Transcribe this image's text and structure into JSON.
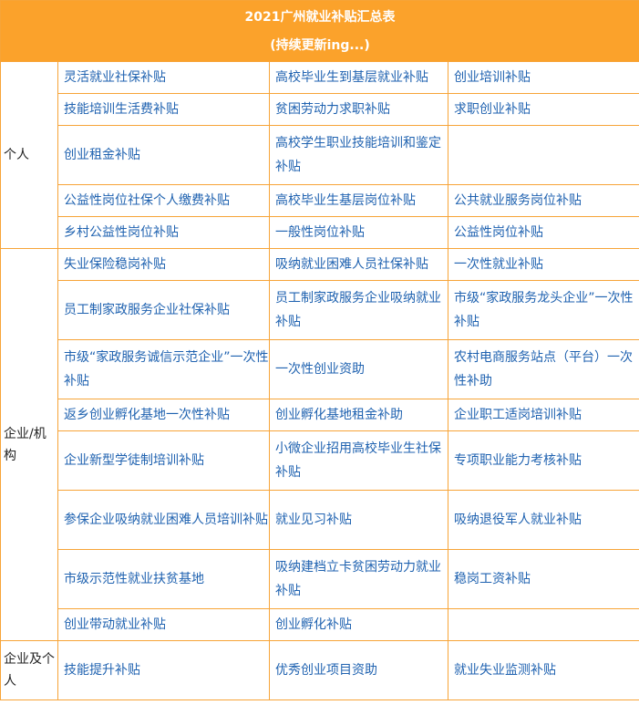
{
  "title": "2021广州就业补贴汇总表",
  "subtitle": "(持续更新ing...)",
  "categories": {
    "individual": "个人",
    "enterprise": "企业/机构",
    "both": "企业及个人"
  },
  "individual_rows": [
    [
      "灵活就业社保补贴",
      "高校毕业生到基层就业补贴",
      "创业培训补贴"
    ],
    [
      "技能培训生活费补贴",
      "贫困劳动力求职补贴",
      "求职创业补贴"
    ],
    [
      "创业租金补贴",
      "高校学生职业技能培训和鉴定补贴",
      ""
    ],
    [
      "公益性岗位社保个人缴费补贴",
      "高校毕业生基层岗位补贴",
      "公共就业服务岗位补贴"
    ],
    [
      "乡村公益性岗位补贴",
      "一般性岗位补贴",
      "公益性岗位补贴"
    ]
  ],
  "enterprise_rows": [
    [
      "失业保险稳岗补贴",
      "吸纳就业困难人员社保补贴",
      "一次性就业补贴"
    ],
    [
      "员工制家政服务企业社保补贴",
      "员工制家政服务企业吸纳就业补贴",
      "市级“家政服务龙头企业”一次性补贴"
    ],
    [
      "市级“家政服务诚信示范企业”一次性补贴",
      "一次性创业资助",
      "农村电商服务站点（平台）一次性补助"
    ],
    [
      "返乡创业孵化基地一次性补贴",
      "创业孵化基地租金补助",
      "企业职工适岗培训补贴"
    ],
    [
      "企业新型学徒制培训补贴",
      "小微企业招用高校毕业生社保补贴",
      "专项职业能力考核补贴"
    ],
    [
      "参保企业吸纳就业困难人员培训补贴",
      "就业见习补贴",
      "吸纳退役军人就业补贴"
    ],
    [
      "市级示范性就业扶贫基地",
      "吸纳建档立卡贫困劳动力就业补贴",
      "稳岗工资补贴"
    ],
    [
      "创业带动就业补贴",
      "创业孵化补贴",
      ""
    ]
  ],
  "both_rows": [
    [
      "技能提升补贴",
      "优秀创业项目资助",
      "就业失业监测补贴"
    ]
  ]
}
